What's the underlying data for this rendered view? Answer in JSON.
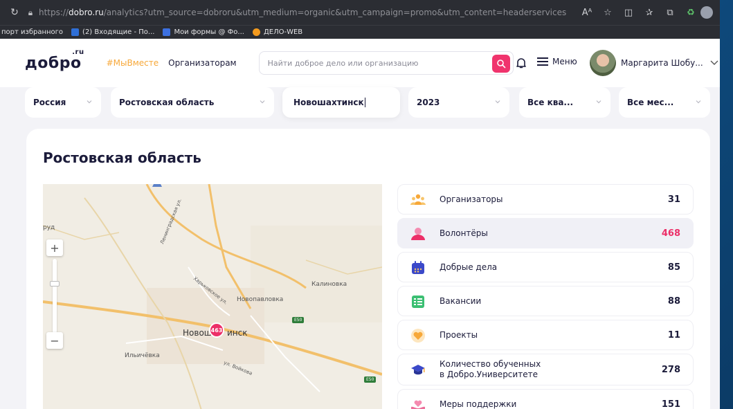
{
  "browser": {
    "url_prefix": "https://",
    "url_domain": "dobro.ru",
    "url_rest": "/analytics?utm_source=dobroru&utm_medium=organic&utm_campaign=promo&utm_content=headerservices",
    "reader_label": "Aᴬ",
    "bookmarks": [
      {
        "label": "порт избранного",
        "color": ""
      },
      {
        "label": "(2) Входящие - По...",
        "color": "#2f6fd6"
      },
      {
        "label": "Мои формы @ Фо...",
        "color": "#3c70e0"
      },
      {
        "label": "ДЕЛО-WEB",
        "color": "#f39a1e"
      }
    ]
  },
  "header": {
    "logo": "добро",
    "logo_ru": ".ru",
    "hashtag": "#МыВместе",
    "organizers_link": "Организаторам",
    "search_placeholder": "Найти доброе дело или организацию",
    "menu_label": "Меню",
    "user_name": "Маргарита Шобу..."
  },
  "filters": {
    "country": "Россия",
    "region": "Ростовская область",
    "city": "Новошахтинск",
    "year": "2023",
    "quarter": "Все ква...",
    "month": "Все мес..."
  },
  "card": {
    "title": "Ростовская область"
  },
  "map": {
    "labels": {
      "rud": "руд",
      "kalinovka": "Калиновка",
      "novopavlovka": "Новопавловка",
      "city_left": "Новош",
      "city_right": "инск",
      "ilyichevka": "Ильичёвка",
      "street_vojkova": "ул. Войкова",
      "street_leningrad": "Ленинградская ул.",
      "street_kharkov": "Харьковское ул."
    },
    "marker_count": "463",
    "road_badges": [
      "E50",
      "E50"
    ],
    "zoom_plus": "+",
    "zoom_minus": "−"
  },
  "stats": [
    {
      "label": "Организаторы",
      "value": "31",
      "icon": "organizers-icon",
      "color": "#f7a839"
    },
    {
      "label": "Волонтёры",
      "value": "468",
      "icon": "volunteer-icon",
      "color": "#ec2f68"
    },
    {
      "label": "Добрые дела",
      "value": "85",
      "icon": "calendar-icon",
      "color": "#3b49c9"
    },
    {
      "label": "Вакансии",
      "value": "88",
      "icon": "list-icon",
      "color": "#3bbf72"
    },
    {
      "label": "Проекты",
      "value": "11",
      "icon": "heart-icon",
      "color": "#f7a839"
    },
    {
      "label": "Количество обученных",
      "label2": "в Добро.Университете",
      "value": "278",
      "icon": "graduation-cap-icon",
      "color": "#3b49c9"
    },
    {
      "label": "Меры поддержки",
      "value": "151",
      "icon": "support-icon",
      "color": "#ec6f9a"
    }
  ]
}
